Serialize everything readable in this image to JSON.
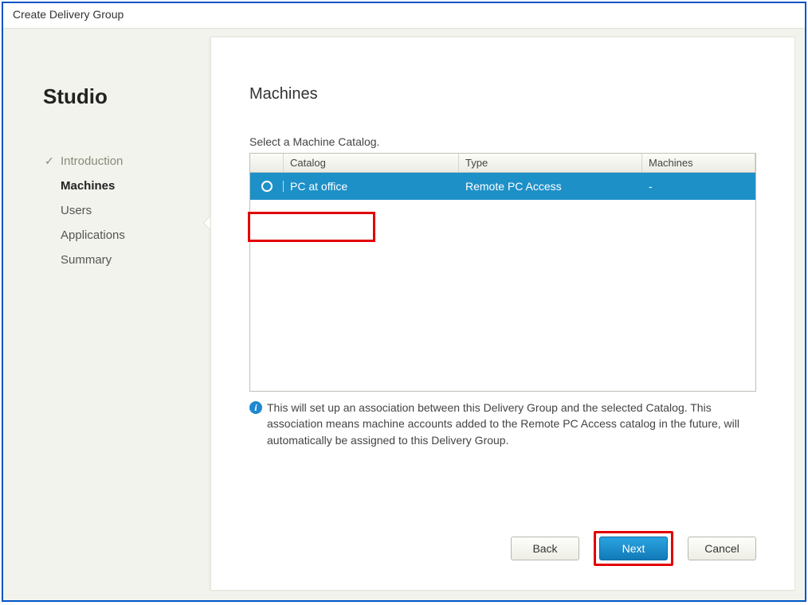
{
  "window": {
    "title": "Create Delivery Group"
  },
  "sidebar": {
    "brand": "Studio",
    "items": [
      {
        "label": "Introduction",
        "state": "completed"
      },
      {
        "label": "Machines",
        "state": "current"
      },
      {
        "label": "Users",
        "state": "pending"
      },
      {
        "label": "Applications",
        "state": "pending"
      },
      {
        "label": "Summary",
        "state": "pending"
      }
    ]
  },
  "main": {
    "heading": "Machines",
    "subheading": "Select a Machine Catalog.",
    "columns": {
      "catalog": "Catalog",
      "type": "Type",
      "machines": "Machines"
    },
    "rows": [
      {
        "catalog": "PC at office",
        "type": "Remote PC Access",
        "machines": "-",
        "selected": true
      }
    ],
    "info_text": "This will set up an association between this Delivery Group and the selected Catalog. This association means machine accounts added to the Remote PC Access catalog in the future, will automatically be assigned to this Delivery Group."
  },
  "buttons": {
    "back": "Back",
    "next": "Next",
    "cancel": "Cancel"
  }
}
